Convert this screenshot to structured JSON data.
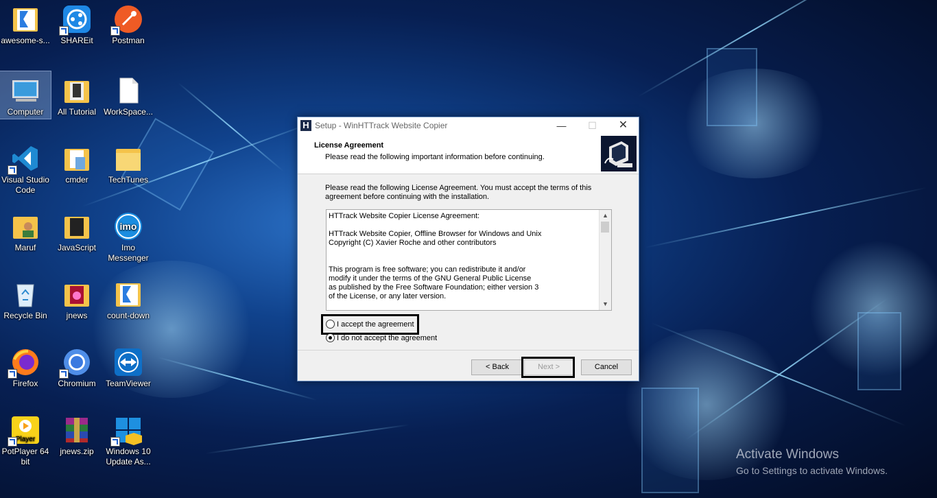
{
  "desktop": {
    "icons": [
      {
        "label": "awesome-s...",
        "icon": "kotlin-folder-icon"
      },
      {
        "label": "SHAREit",
        "icon": "shareit-icon"
      },
      {
        "label": "Postman",
        "icon": "postman-icon"
      },
      {
        "label": "Computer",
        "icon": "computer-icon"
      },
      {
        "label": "All Tutorial",
        "icon": "folder-icon"
      },
      {
        "label": "WorkSpace...",
        "icon": "file-icon"
      },
      {
        "label": "Visual Studio Code",
        "icon": "vscode-icon"
      },
      {
        "label": "cmder",
        "icon": "folder-icon"
      },
      {
        "label": "TechTunes",
        "icon": "folder-icon"
      },
      {
        "label": "Maruf",
        "icon": "user-folder-icon"
      },
      {
        "label": "JavaScript",
        "icon": "folder-icon"
      },
      {
        "label": "Imo Messenger",
        "icon": "imo-icon"
      },
      {
        "label": "Recycle Bin",
        "icon": "recycle-bin-icon"
      },
      {
        "label": "jnews",
        "icon": "folder-icon"
      },
      {
        "label": "count-down",
        "icon": "kotlin-folder-icon"
      },
      {
        "label": "Firefox",
        "icon": "firefox-icon"
      },
      {
        "label": "Chromium",
        "icon": "chromium-icon"
      },
      {
        "label": "TeamViewer",
        "icon": "teamviewer-icon"
      },
      {
        "label": "PotPlayer 64 bit",
        "icon": "potplayer-icon"
      },
      {
        "label": "jnews.zip",
        "icon": "winrar-icon"
      },
      {
        "label": "Windows 10 Update As...",
        "icon": "windows-update-icon"
      }
    ],
    "watermark": {
      "line1": "Activate Windows",
      "line2": "Go to Settings to activate Windows."
    }
  },
  "dialog": {
    "title": "Setup - WinHTTrack Website Copier",
    "app_icon_letter": "H",
    "header_title": "License Agreement",
    "header_subtitle": "Please read the following important information before continuing.",
    "intro": "Please read the following License Agreement. You must accept the terms of this agreement before continuing with the installation.",
    "license_text": "HTTrack Website Copier License Agreement:\n\nHTTrack Website Copier, Offline Browser for Windows and Unix\nCopyright (C) Xavier Roche and other contributors\n\n\nThis program is free software; you can redistribute it and/or\nmodify it under the terms of the GNU General Public License\nas published by the Free Software Foundation; either version 3\nof the License, or any later version.",
    "accept_label": "I accept the agreement",
    "decline_label": "I do not accept the agreement",
    "accept_checked": false,
    "decline_checked": true,
    "back_label": "< Back",
    "next_label": "Next >",
    "cancel_label": "Cancel",
    "next_enabled": false
  }
}
